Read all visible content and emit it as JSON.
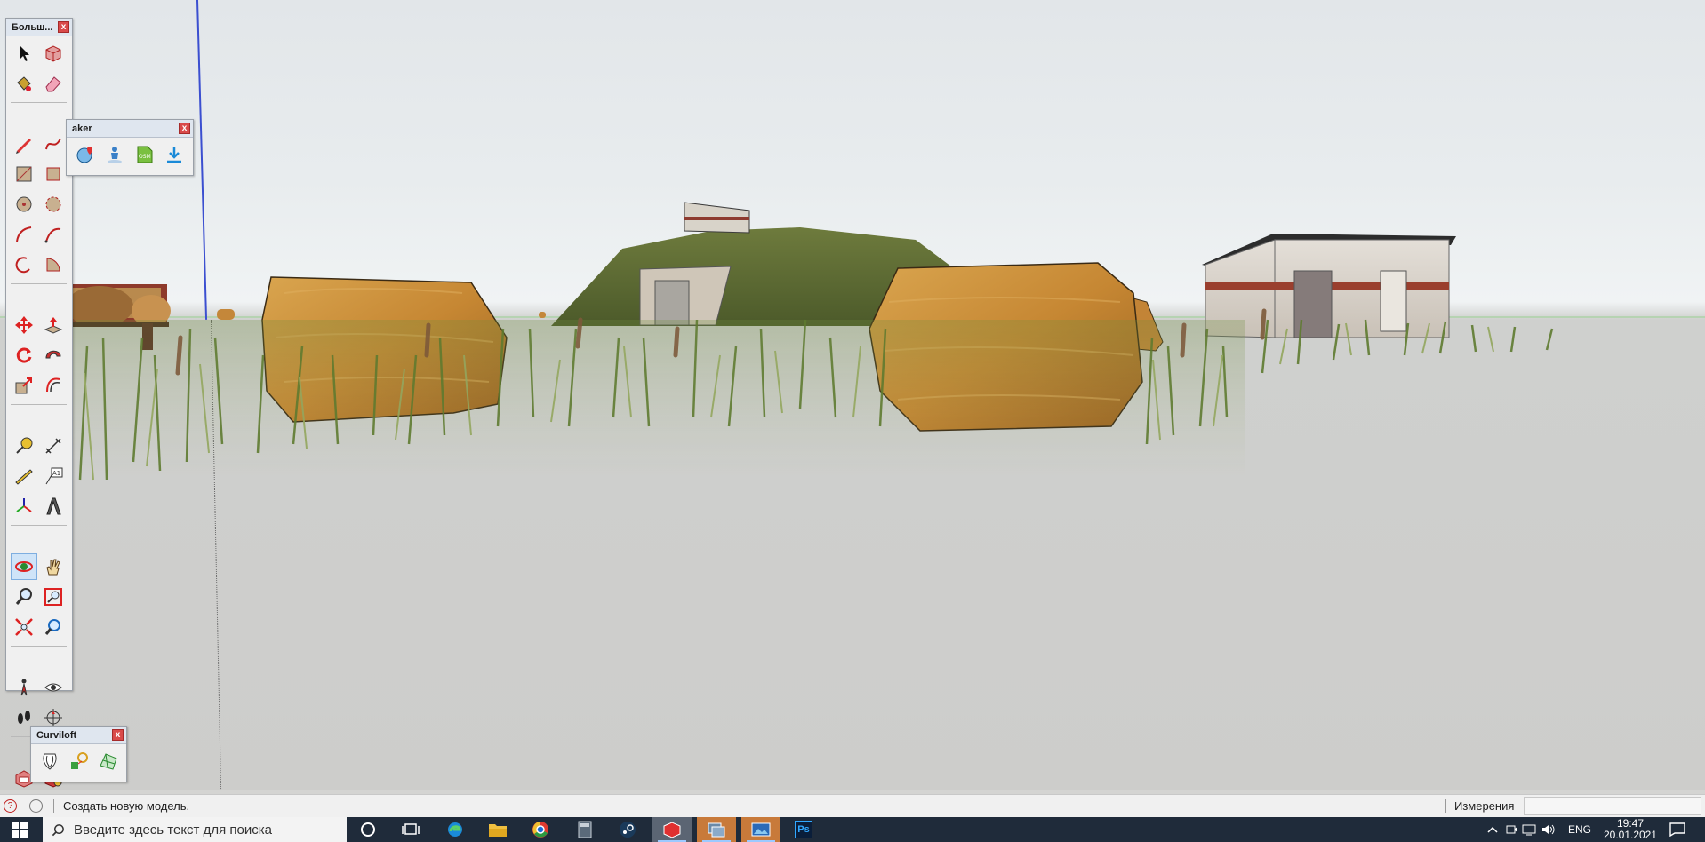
{
  "toolbars": {
    "large": {
      "title": "Больш...",
      "close": "x"
    },
    "geo": {
      "title": "aker",
      "close": "x"
    },
    "curviloft": {
      "title": "Curviloft",
      "close": "x"
    }
  },
  "status": {
    "message": "Создать новую модель.",
    "measure_label": "Измерения",
    "measure_value": ""
  },
  "taskbar": {
    "search_placeholder": "Введите здесь текст для поиска",
    "language": "ENG",
    "time": "19:47",
    "date": "20.01.2021",
    "ps_label": "Ps"
  },
  "colors": {
    "taskbar_bg": "#1f2b3a",
    "hay": "#c88b3a",
    "sky": "#e6eaec",
    "ground": "#cdcdcb"
  }
}
